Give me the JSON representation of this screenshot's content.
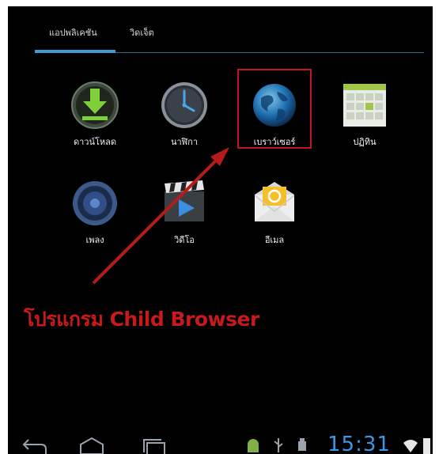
{
  "tabs": {
    "apps_label": "แอปพลิเคชัน",
    "widgets_label": "วิดเจ็ต"
  },
  "apps": [
    {
      "label": "ดาวน์โหลด",
      "icon": "download-icon"
    },
    {
      "label": "นาฬิกา",
      "icon": "clock-icon"
    },
    {
      "label": "เบราว์เซอร์",
      "icon": "globe-icon"
    },
    {
      "label": "ปฏิทิน",
      "icon": "calendar-icon"
    },
    {
      "label": "เพลง",
      "icon": "speaker-icon"
    },
    {
      "label": "วิดีโอ",
      "icon": "video-icon"
    },
    {
      "label": "อีเมล",
      "icon": "email-icon"
    }
  ],
  "annotation": {
    "caption": "โปรแกรม Child Browser",
    "color": "#c81a1a"
  },
  "statusbar": {
    "time": "15:31"
  },
  "colors": {
    "accent": "#3a9fd6",
    "background": "#000000"
  }
}
